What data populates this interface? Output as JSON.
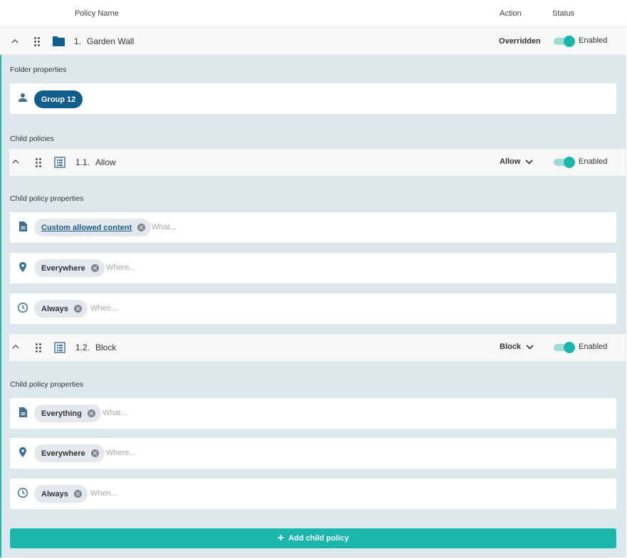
{
  "header": {
    "col_name": "Policy Name",
    "col_action": "Action",
    "col_status": "Status"
  },
  "folder": {
    "number": "1.",
    "name": "Garden Wall",
    "action": "Overridden",
    "status": "Enabled",
    "properties_label": "Folder properties",
    "group_chip": "Group 12"
  },
  "child_policies_label": "Child policies",
  "children": [
    {
      "number": "1.1.",
      "name": "Allow",
      "action": "Allow",
      "status": "Enabled",
      "properties_label": "Child policy properties",
      "what_chip": "Custom allowed content",
      "what_placeholder": "What...",
      "where_chip": "Everywhere",
      "where_placeholder": "Where...",
      "when_chip": "Always",
      "when_placeholder": "When..."
    },
    {
      "number": "1.2.",
      "name": "Block",
      "action": "Block",
      "status": "Enabled",
      "properties_label": "Child policy properties",
      "what_chip": "Everything",
      "what_placeholder": "What...",
      "where_chip": "Everywhere",
      "where_placeholder": "Where...",
      "when_chip": "Always",
      "when_placeholder": "When..."
    }
  ],
  "add_button": "Add child policy",
  "colors": {
    "accent": "#1ab6ac",
    "panel": "#dde8ed",
    "brand_blue": "#115e8c",
    "icon_blue": "#3f6f96"
  }
}
